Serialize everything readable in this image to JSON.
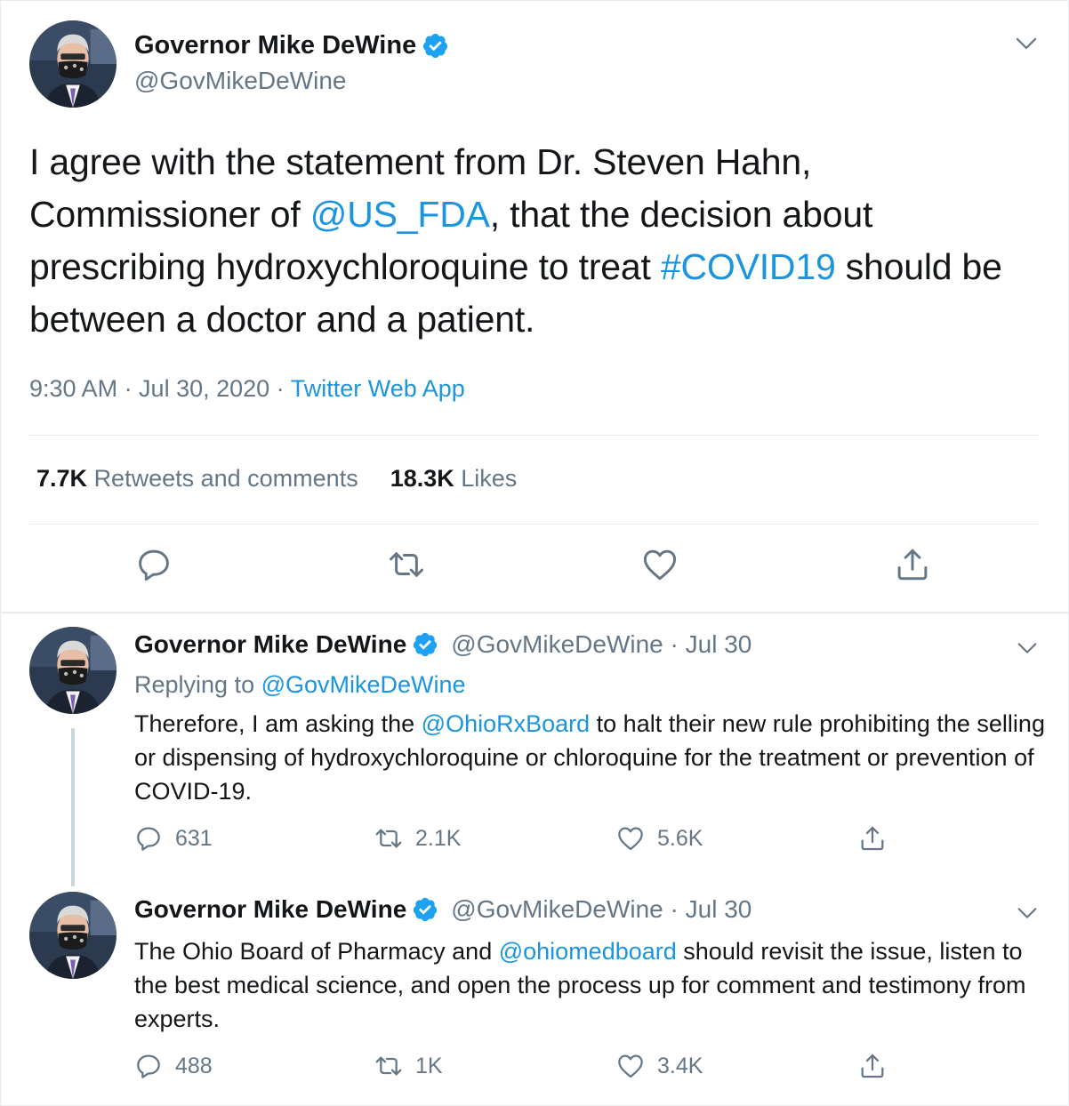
{
  "main_tweet": {
    "name": "Governor Mike DeWine",
    "handle": "@GovMikeDeWine",
    "text_1": "I agree with the statement from Dr. Steven Hahn, Commissioner of ",
    "mention_1": "@US_FDA",
    "text_2": ", that the decision about prescribing hydroxychloroquine to treat ",
    "hashtag": "#COVID19",
    "text_3": " should be between a doctor and a patient.",
    "time": "9:30 AM · Jul 30, 2020 · ",
    "source": "Twitter Web App",
    "retweets_count": "7.7K",
    "retweets_label": "Retweets and comments",
    "likes_count": "18.3K",
    "likes_label": "Likes"
  },
  "replies": [
    {
      "name": "Governor Mike DeWine",
      "handle": "@GovMikeDeWine · Jul 30",
      "replying_label": "Replying to ",
      "replying_handle": "@GovMikeDeWine",
      "text_1": "Therefore, I am asking the ",
      "mention": "@OhioRxBoard",
      "text_2": " to halt their new rule prohibiting the selling or dispensing of hydroxychloroquine or chloroquine for the treatment or prevention of COVID-19.",
      "comments": "631",
      "retweets": "2.1K",
      "likes": "5.6K"
    },
    {
      "name": "Governor Mike DeWine",
      "handle": "@GovMikeDeWine · Jul 30",
      "text_1": "The Ohio Board of Pharmacy and ",
      "mention": "@ohiomedboard",
      "text_2": " should revisit the issue, listen to the best medical science, and open the process up for comment and testimony from experts.",
      "comments": "488",
      "retweets": "1K",
      "likes": "3.4K"
    }
  ],
  "colors": {
    "link": "#1b95e0",
    "verified": "#1da1f2",
    "secondary_text": "#657786",
    "border": "#e6ecf0"
  },
  "icons": [
    "verified-badge-icon",
    "chevron-down-icon",
    "reply-icon",
    "retweet-icon",
    "like-icon",
    "share-icon"
  ]
}
